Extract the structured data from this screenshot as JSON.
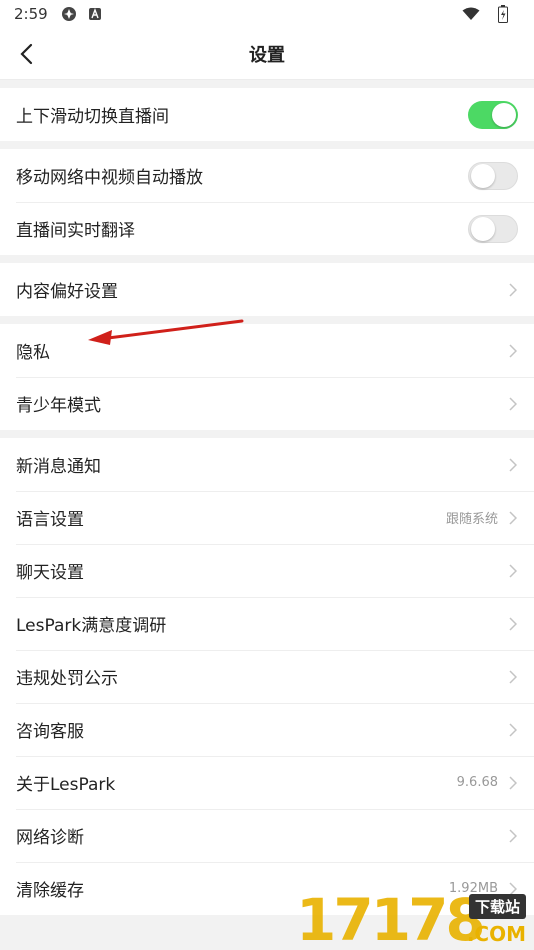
{
  "status_bar": {
    "time": "2:59"
  },
  "nav": {
    "title": "设置"
  },
  "groups": [
    {
      "rows": [
        {
          "label": "上下滑动切换直播间",
          "toggle": "on"
        }
      ]
    },
    {
      "rows": [
        {
          "label": "移动网络中视频自动播放",
          "toggle": "off"
        },
        {
          "label": "直播间实时翻译",
          "toggle": "off"
        }
      ]
    },
    {
      "rows": [
        {
          "label": "内容偏好设置"
        }
      ]
    },
    {
      "rows": [
        {
          "label": "隐私"
        },
        {
          "label": "青少年模式"
        }
      ]
    },
    {
      "rows": [
        {
          "label": "新消息通知"
        },
        {
          "label": "语言设置",
          "value": "跟随系统"
        },
        {
          "label": "聊天设置"
        },
        {
          "label": "LesPark满意度调研"
        },
        {
          "label": "违规处罚公示"
        },
        {
          "label": "咨询客服"
        },
        {
          "label": "关于LesPark",
          "value": "9.6.68"
        },
        {
          "label": "网络诊断"
        },
        {
          "label": "清除缓存",
          "value": "1.92MB"
        }
      ]
    }
  ],
  "watermark": {
    "digits": "17178",
    "badge": "下载站",
    "suffix": ".COM"
  },
  "colors": {
    "toggle_on": "#4cd964",
    "annotation_arrow": "#d0201a",
    "watermark": "#e9b200"
  }
}
